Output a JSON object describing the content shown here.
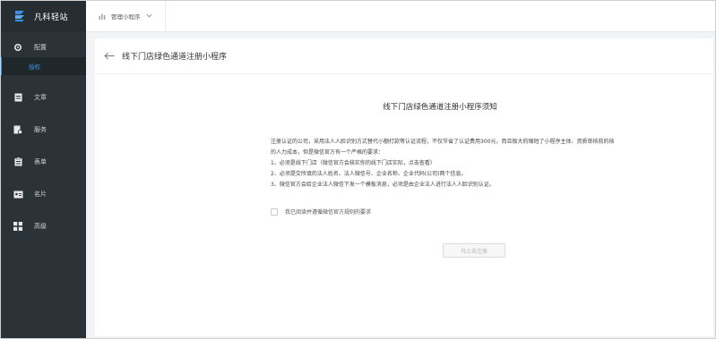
{
  "brand": {
    "name": "凡科轻站"
  },
  "sidebar": {
    "items": [
      {
        "label": "配置",
        "icon": "gear-icon"
      },
      {
        "label": "文章",
        "icon": "document-icon"
      },
      {
        "label": "服务",
        "icon": "service-icon"
      },
      {
        "label": "表单",
        "icon": "form-icon"
      },
      {
        "label": "名片",
        "icon": "card-icon"
      },
      {
        "label": "高级",
        "icon": "grid-icon"
      }
    ],
    "sub_item": {
      "label": "授权"
    }
  },
  "topbar": {
    "app_label": "管理小程序"
  },
  "page": {
    "title": "线下门店绿色通道注册小程序",
    "notice_title": "线下门店绿色通道注册小程序须知",
    "notice_lines": [
      "注册认证的公司，采用法人人脸识别方式替代小额打款等认证流程，不仅节省了认证费用300元，而且极大的缩短了小程序主体、资质审核前的核",
      "的人力成本，但是微信官方有一个严格的要求：",
      "1、必须是线下门店（微信官方会核实你的线下门店实际，点击查看）",
      "2、必须提交所填的法人姓名、法人微信号、企业名称、企业代码(公司)两个信息。",
      "3、微信官方会给企业法人微信下发一个模板消息，必须是由企业法人进行法人人脸识别认证。"
    ],
    "agree_text": "我已阅读并遵循微信官方规则的要求",
    "register_button": "马上去注册"
  }
}
